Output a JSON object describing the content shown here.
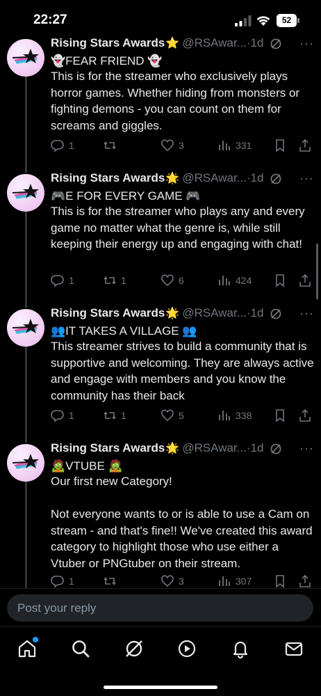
{
  "status_bar": {
    "time": "22:27",
    "battery": "52"
  },
  "colors": {
    "background": "#000000",
    "text": "#e7e9ea",
    "muted": "#71767b",
    "accent": "#1d9bf0",
    "badge": "#f4b400"
  },
  "tweets": [
    {
      "name": "Rising Stars Awards",
      "badge_icon": "star-badge-icon",
      "handle": "@RSAwar...",
      "sep": "·",
      "age": "1d",
      "title": "👻FEAR FRIEND 👻",
      "text": "This is for the streamer who exclusively plays horror games. Whether hiding from monsters or fighting demons - you can count on them for screams and giggles.",
      "replies": "1",
      "retweets": "",
      "likes": "3",
      "views": "331"
    },
    {
      "name": "Rising Stars Awards",
      "badge_icon": "star-badge-icon",
      "handle": "@RSAwar...",
      "sep": "·",
      "age": "1d",
      "title": "🎮E FOR EVERY GAME 🎮",
      "text": "This is for the streamer who plays any and every game no matter what the genre is, while still keeping their energy up and engaging with chat!",
      "replies": "1",
      "retweets": "1",
      "likes": "6",
      "views": "424"
    },
    {
      "name": "Rising Stars Awards",
      "badge_icon": "star-badge-icon",
      "handle": "@RSAwar...",
      "sep": "·",
      "age": "1d",
      "title": "👥IT TAKES A VILLAGE 👥",
      "text": "This streamer strives to build a community that is supportive and welcoming. They are always active and engage with members and you know the community has their back",
      "replies": "1",
      "retweets": "1",
      "likes": "5",
      "views": "338"
    },
    {
      "name": "Rising Stars Awards",
      "badge_icon": "star-badge-icon",
      "handle": "@RSAwar...",
      "sep": "·",
      "age": "1d",
      "title": "🧟VTUBE 🧟",
      "text": "Our first new Category!\n\nNot everyone wants to or is able to use a Cam on stream - and that's fine!! We've created this award category to highlight those who use either a Vtuber or PNGtuber on their stream.",
      "replies": "1",
      "retweets": "",
      "likes": "3",
      "views": "307"
    }
  ],
  "reply_bar": {
    "placeholder": "Post your reply"
  },
  "nav": [
    "home-icon",
    "search-icon",
    "grok-icon",
    "video-icon",
    "notifications-icon",
    "messages-icon"
  ]
}
